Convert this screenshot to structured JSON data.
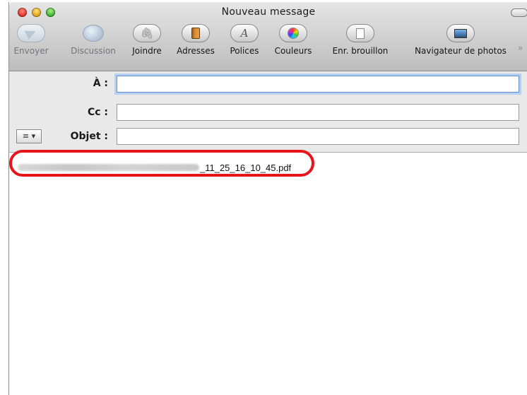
{
  "window": {
    "title": "Nouveau message"
  },
  "toolbar": {
    "buttons": [
      {
        "label": "Envoyer",
        "icon": "send-icon",
        "enabled": false
      },
      {
        "label": "Discussion",
        "icon": "chat-bubble-icon",
        "enabled": false
      },
      {
        "label": "Joindre",
        "icon": "paperclip-icon",
        "enabled": true
      },
      {
        "label": "Adresses",
        "icon": "address-book-icon",
        "enabled": true
      },
      {
        "label": "Polices",
        "icon": "font-icon",
        "enabled": true
      },
      {
        "label": "Couleurs",
        "icon": "color-wheel-icon",
        "enabled": true
      },
      {
        "label": "Enr. brouillon",
        "icon": "draft-document-icon",
        "enabled": true
      },
      {
        "label": "Navigateur de photos",
        "icon": "photo-browser-icon",
        "enabled": true
      }
    ],
    "overflow_glyph": "»"
  },
  "fields": {
    "to": {
      "label": "À :",
      "value": ""
    },
    "cc": {
      "label": "Cc :",
      "value": ""
    },
    "subject": {
      "label": "Objet :",
      "value": ""
    },
    "format_menu_glyph": "≡ ▾"
  },
  "body": {
    "attachment": {
      "suffix": "_11_25_16_10_45.pdf"
    }
  },
  "colors": {
    "highlight": "#e8141c",
    "focus_ring": "#b7d0f0"
  }
}
